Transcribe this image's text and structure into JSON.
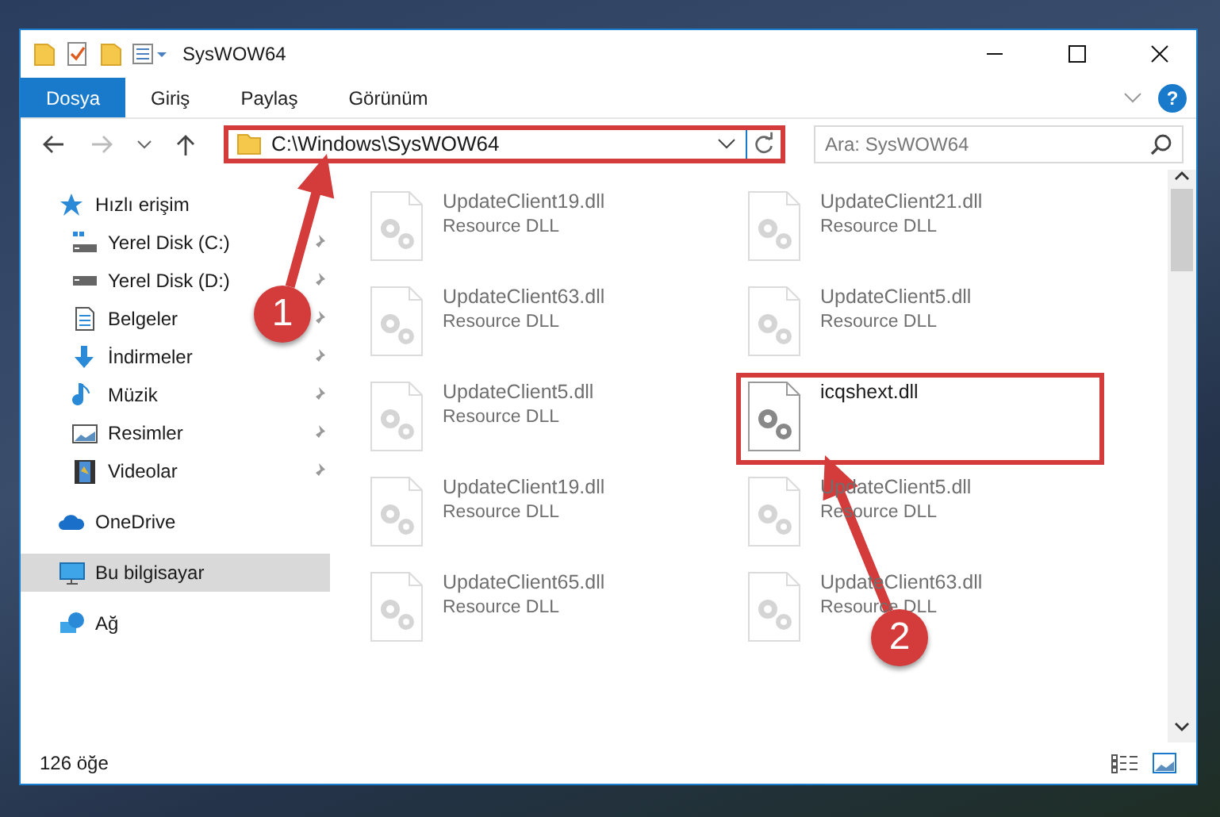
{
  "window": {
    "title": "SysWOW64"
  },
  "ribbon_tabs": [
    {
      "label": "Dosya",
      "selected": true
    },
    {
      "label": "Giriş",
      "selected": false
    },
    {
      "label": "Paylaş",
      "selected": false
    },
    {
      "label": "Görünüm",
      "selected": false
    }
  ],
  "help": "?",
  "address": {
    "path": "C:\\Windows\\SysWOW64",
    "highlighted": true
  },
  "search": {
    "placeholder": "Ara: SysWOW64"
  },
  "sidebar": {
    "items": [
      {
        "label": "Hızlı erişim",
        "selected": false,
        "children": [
          {
            "label": "Yerel Disk (C:)",
            "pinned": true
          },
          {
            "label": "Yerel Disk (D:)",
            "pinned": true
          },
          {
            "label": "Belgeler",
            "pinned": true
          },
          {
            "label": "İndirmeler",
            "pinned": true
          },
          {
            "label": "Müzik",
            "pinned": true
          },
          {
            "label": "Resimler",
            "pinned": true
          },
          {
            "label": "Videolar",
            "pinned": true
          }
        ]
      },
      {
        "label": "OneDrive",
        "selected": false
      },
      {
        "label": "Bu bilgisayar",
        "selected": true
      },
      {
        "label": "Ağ",
        "selected": false
      }
    ]
  },
  "files": [
    {
      "name": "UpdateClient19.dll",
      "type": "Resource DLL",
      "blurred": true,
      "highlighted": false
    },
    {
      "name": "UpdateClient21.dll",
      "type": "Resource DLL",
      "blurred": true,
      "highlighted": false
    },
    {
      "name": "UpdateClient63.dll",
      "type": "Resource DLL",
      "blurred": true,
      "highlighted": false
    },
    {
      "name": "UpdateClient5.dll",
      "type": "Resource DLL",
      "blurred": true,
      "highlighted": false
    },
    {
      "name": "UpdateClient5.dll",
      "type": "Resource DLL",
      "blurred": true,
      "highlighted": false
    },
    {
      "name": "icqshext.dll",
      "blurred": false,
      "highlighted": true
    },
    {
      "name": "UpdateClient19.dll",
      "type": "Resource DLL",
      "blurred": true,
      "highlighted": false
    },
    {
      "name": "UpdateClient5.dll",
      "type": "Resource DLL",
      "blurred": true,
      "highlighted": false
    },
    {
      "name": "UpdateClient65.dll",
      "type": "Resource DLL",
      "blurred": true,
      "highlighted": false
    },
    {
      "name": "UpdateClient63.dll",
      "type": "Resource DLL",
      "blurred": true,
      "highlighted": false
    }
  ],
  "status_bar": {
    "count": "126 öğe"
  },
  "callouts": [
    {
      "number": "1"
    },
    {
      "number": "2"
    }
  ]
}
